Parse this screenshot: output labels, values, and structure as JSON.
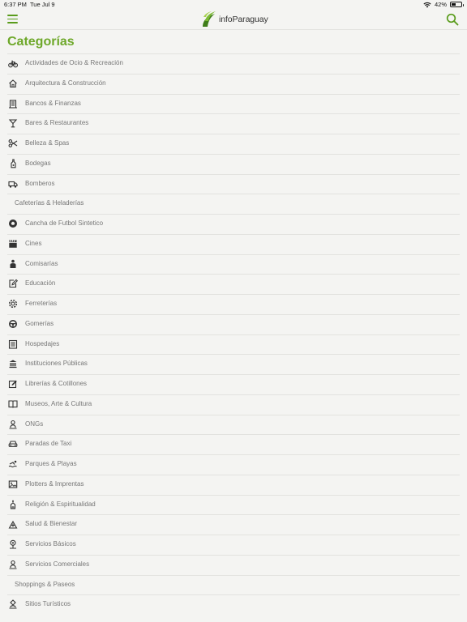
{
  "status": {
    "time": "6:37 PM",
    "date": "Tue Jul 9",
    "battery": "42%",
    "battery_level": 0.42
  },
  "header": {
    "logo_text": "infoParaguay",
    "brand_color": "#6ea82a",
    "menu_icon": "hamburger-icon",
    "search_icon": "search-icon"
  },
  "title": "Categorías",
  "categories": [
    {
      "label": "Actividades de Ocio & Recreación",
      "icon": "bicycle-icon"
    },
    {
      "label": "Arquitectura & Construcción",
      "icon": "house-icon"
    },
    {
      "label": "Bancos & Finanzas",
      "icon": "bank-icon"
    },
    {
      "label": "Bares & Restaurantes",
      "icon": "cocktail-icon"
    },
    {
      "label": "Belleza & Spas",
      "icon": "scissors-icon"
    },
    {
      "label": "Bodegas",
      "icon": "bottle-icon"
    },
    {
      "label": "Bomberos",
      "icon": "firetruck-icon"
    },
    {
      "label": "Cafeterías & Heladerías",
      "icon": ""
    },
    {
      "label": "Cancha de Futbol Sintetico",
      "icon": "soccer-ball-icon"
    },
    {
      "label": "Cines",
      "icon": "clapperboard-icon"
    },
    {
      "label": "Comisarías",
      "icon": "police-icon"
    },
    {
      "label": "Educación",
      "icon": "edit-note-icon"
    },
    {
      "label": "Ferreterías",
      "icon": "gear-icon"
    },
    {
      "label": "Gomerías",
      "icon": "steering-wheel-icon"
    },
    {
      "label": "Hospedajes",
      "icon": "hotel-icon"
    },
    {
      "label": "Instituciones Públicas",
      "icon": "institution-icon"
    },
    {
      "label": "Librerías & Cotillones",
      "icon": "pencil-square-icon"
    },
    {
      "label": "Museos, Arte & Cultura",
      "icon": "book-icon"
    },
    {
      "label": "ONGs",
      "icon": "person-pin-icon"
    },
    {
      "label": "Paradas de Taxi",
      "icon": "car-icon"
    },
    {
      "label": "Parques & Playas",
      "icon": "swimmer-icon"
    },
    {
      "label": "Plotters & Imprentas",
      "icon": "image-icon"
    },
    {
      "label": "Religión & Espiritualidad",
      "icon": "church-icon"
    },
    {
      "label": "Salud & Bienestar",
      "icon": "hospital-icon"
    },
    {
      "label": "Servicios Básicos",
      "icon": "water-pin-icon"
    },
    {
      "label": "Servicios Comerciales",
      "icon": "person-pin-icon"
    },
    {
      "label": "Shoppings & Paseos",
      "icon": ""
    },
    {
      "label": "Sitios Turísticos",
      "icon": "landmark-pin-icon"
    }
  ]
}
